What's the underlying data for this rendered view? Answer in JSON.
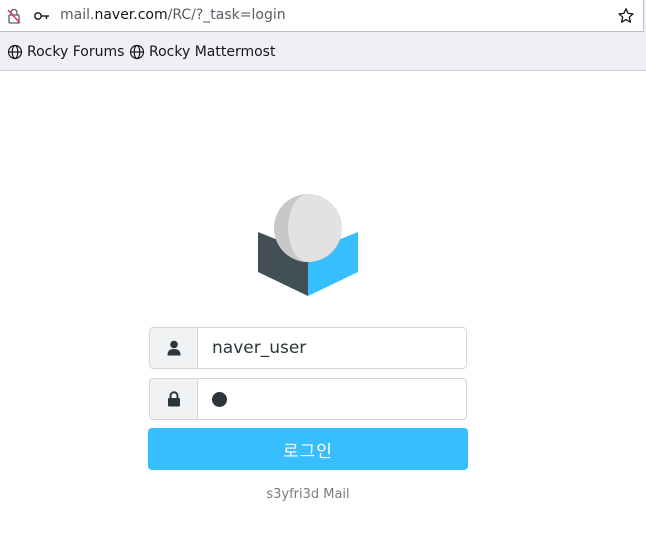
{
  "browser": {
    "url_prefix": "mail.",
    "url_host": "naver.com",
    "url_path": "/RC/?_task=login",
    "bookmarks": [
      {
        "label": "Rocky Forums",
        "icon": "globe-icon"
      },
      {
        "label": "Rocky Mattermost",
        "icon": "globe-icon"
      }
    ]
  },
  "login": {
    "username_value": "naver_user",
    "username_icon": "user-icon",
    "password_icon": "lock-icon",
    "submit_label": "로그인",
    "footer": "s3yfri3d Mail"
  },
  "colors": {
    "accent": "#37beff",
    "dark": "#2c363a",
    "logo_dark": "#424f55",
    "logo_light": "#e2e2e2"
  }
}
